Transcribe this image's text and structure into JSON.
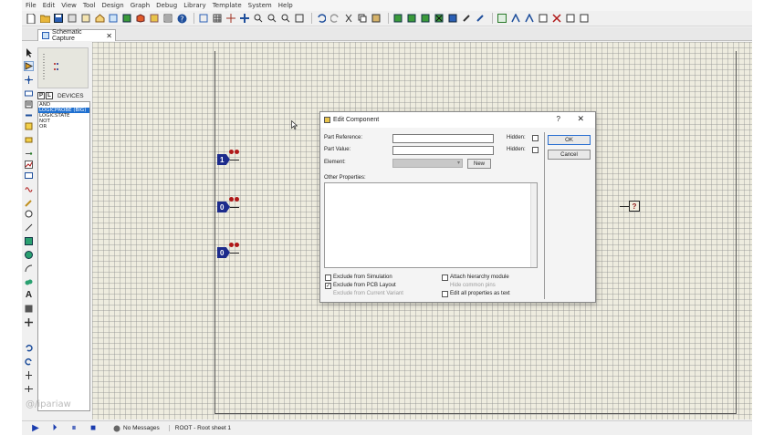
{
  "menu": [
    "File",
    "Edit",
    "View",
    "Tool",
    "Design",
    "Graph",
    "Debug",
    "Library",
    "Template",
    "System",
    "Help"
  ],
  "tab": {
    "label": "Schematic Capture",
    "close": "✕"
  },
  "selector": {
    "p": "P",
    "l": "L",
    "header": "DEVICES",
    "devices": [
      "AND",
      "LOGICPROBE (BIG)",
      "LOGICSTATE",
      "NOT",
      "OR"
    ]
  },
  "canvas": {
    "probes": [
      "1",
      "0",
      "0"
    ],
    "unknown_probe": "?"
  },
  "dialog": {
    "title": "Edit Component",
    "help": "?",
    "close": "✕",
    "part_reference_label": "Part Reference:",
    "part_value_label": "Part Value:",
    "element_label": "Element:",
    "hidden_label_1": "Hidden:",
    "hidden_label_2": "Hidden:",
    "new_button": "New",
    "ok_button": "OK",
    "cancel_button": "Cancel",
    "other_properties_label": "Other Properties:",
    "options": {
      "exclude_simulation": "Exclude from Simulation",
      "exclude_pcb": "Exclude from PCB Layout",
      "exclude_variant": "Exclude from Current Variant",
      "attach_hierarchy": "Attach hierarchy module",
      "hide_common_pins": "Hide common pins",
      "edit_all_text": "Edit all properties as text"
    },
    "exclude_pcb_checked": "✓"
  },
  "status": {
    "messages": "No Messages",
    "sheet": "ROOT - Root sheet 1"
  },
  "watermark": "@/ipariaw",
  "colors": {
    "canvas": "#eeecdf",
    "probe": "#1c2b8c",
    "selection": "#1e6fd0",
    "ok_border": "#2a6fd1"
  }
}
